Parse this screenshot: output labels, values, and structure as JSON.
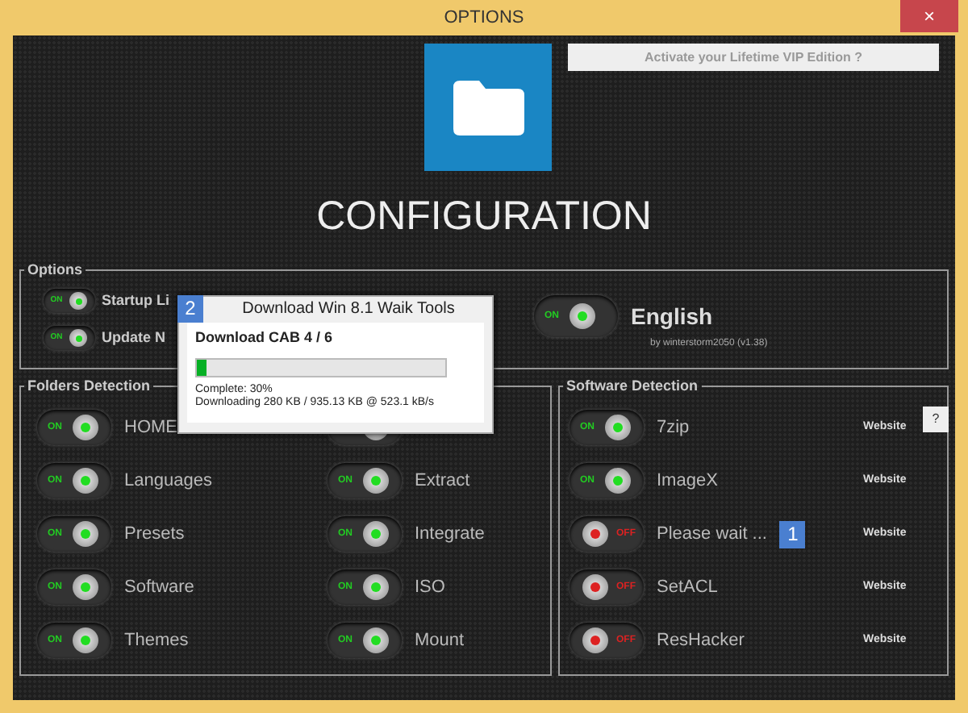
{
  "window": {
    "title": "OPTIONS",
    "close": "×"
  },
  "vip_button": "Activate your Lifetime VIP Edition ?",
  "heading": "CONFIGURATION",
  "options": {
    "legend": "Options",
    "items": [
      {
        "label": "Startup Li",
        "on": true,
        "switch_text": "ON"
      },
      {
        "label": "Update N",
        "on": true,
        "switch_text": "ON"
      }
    ],
    "language": {
      "label": "English",
      "on": true,
      "switch_text": "ON"
    },
    "credit": "by winterstorm2050 (v1.38)"
  },
  "folders": {
    "legend": "Folders Detection",
    "items": [
      {
        "label": "HOME",
        "on": true,
        "switch_text": "ON"
      },
      {
        "on": true
      },
      {
        "label": "Languages",
        "on": true,
        "switch_text": "ON"
      },
      {
        "label": "Extract",
        "on": true,
        "switch_text": "ON"
      },
      {
        "label": "Presets",
        "on": true,
        "switch_text": "ON"
      },
      {
        "label": "Integrate",
        "on": true,
        "switch_text": "ON"
      },
      {
        "label": "Software",
        "on": true,
        "switch_text": "ON"
      },
      {
        "label": "ISO",
        "on": true,
        "switch_text": "ON"
      },
      {
        "label": "Themes",
        "on": true,
        "switch_text": "ON"
      },
      {
        "label": "Mount",
        "on": true,
        "switch_text": "ON"
      }
    ]
  },
  "software": {
    "legend": "Software Detection",
    "help": "?",
    "items": [
      {
        "label": "7zip",
        "on": true,
        "switch_text": "ON",
        "link": "Website"
      },
      {
        "label": "ImageX",
        "on": true,
        "switch_text": "ON",
        "link": "Website"
      },
      {
        "label": "Please wait ...",
        "on": false,
        "switch_text": "OFF",
        "link": "Website",
        "badge": "1"
      },
      {
        "label": "SetACL",
        "on": false,
        "switch_text": "OFF",
        "link": "Website"
      },
      {
        "label": "ResHacker",
        "on": false,
        "switch_text": "OFF",
        "link": "Website"
      }
    ]
  },
  "dialog": {
    "badge": "2",
    "title": "Download Win 8.1 Waik Tools",
    "heading": "Download CAB 4 / 6",
    "level": 0.04,
    "complete": "Complete: 30%",
    "status": "Downloading 280 KB / 935.13 KB @ 523.1 kB/s"
  }
}
